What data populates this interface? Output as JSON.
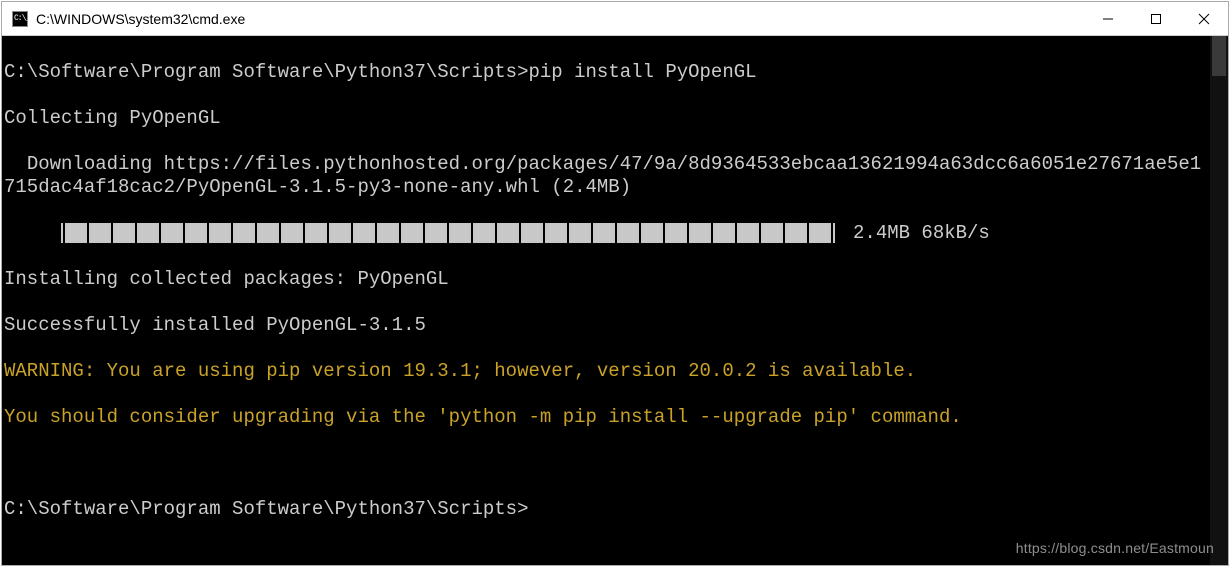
{
  "window": {
    "title": "C:\\WINDOWS\\system32\\cmd.exe"
  },
  "term": {
    "prompt1_path": "C:\\Software\\Program Software\\Python37\\Scripts>",
    "prompt1_cmd": "pip install PyOpenGL",
    "collecting": "Collecting PyOpenGL",
    "downloading": "  Downloading https://files.pythonhosted.org/packages/47/9a/8d9364533ebcaa13621994a63dcc6a6051e27671ae5e1715dac4af18cac2/PyOpenGL-3.1.5-py3-none-any.whl (2.4MB)",
    "progress_segments": 32,
    "progress_label": "2.4MB 68kB/s",
    "installing": "Installing collected packages: PyOpenGL",
    "success": "Successfully installed PyOpenGL-3.1.5",
    "warn1": "WARNING: You are using pip version 19.3.1; however, version 20.0.2 is available.",
    "warn2": "You should consider upgrading via the 'python -m pip install --upgrade pip' command.",
    "prompt2_path": "C:\\Software\\Program Software\\Python37\\Scripts>"
  },
  "watermark": "https://blog.csdn.net/Eastmoun"
}
